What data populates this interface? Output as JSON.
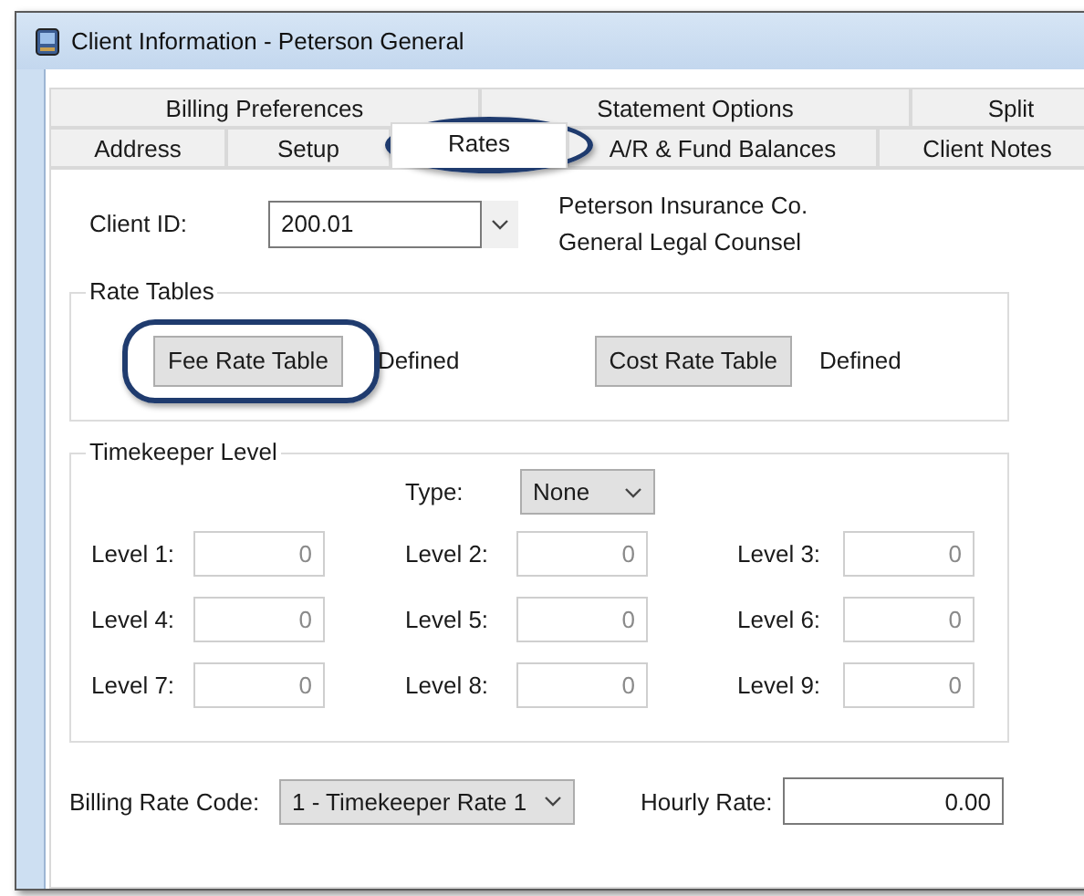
{
  "window": {
    "title": "Client Information - Peterson General"
  },
  "tab_rows": [
    {
      "tabs": [
        {
          "label": "Billing Preferences",
          "selected": false,
          "highlighted": false
        },
        {
          "label": "Statement Options",
          "selected": false,
          "highlighted": false
        },
        {
          "label": "Split",
          "selected": false,
          "highlighted": false
        }
      ]
    },
    {
      "tabs": [
        {
          "label": "Address",
          "selected": false,
          "highlighted": false
        },
        {
          "label": "Setup",
          "selected": false,
          "highlighted": false
        },
        {
          "label": "Rates",
          "selected": true,
          "highlighted": true
        },
        {
          "label": "A/R & Fund Balances",
          "selected": false,
          "highlighted": false
        },
        {
          "label": "Client Notes",
          "selected": false,
          "highlighted": false
        }
      ]
    }
  ],
  "client": {
    "label": "Client ID:",
    "value": "200.01",
    "names": [
      "Peterson Insurance Co.",
      "General Legal Counsel"
    ]
  },
  "rate_tables": {
    "title": "Rate Tables",
    "items": [
      {
        "button": "Fee Rate Table",
        "status": "Defined",
        "highlighted": true
      },
      {
        "button": "Cost Rate Table",
        "status": "Defined",
        "highlighted": false
      }
    ]
  },
  "timekeeper_level": {
    "title": "Timekeeper Level",
    "type_label": "Type:",
    "type_value": "None",
    "levels": [
      {
        "label": "Level 1:",
        "value": "0",
        "disabled": true
      },
      {
        "label": "Level 2:",
        "value": "0",
        "disabled": true
      },
      {
        "label": "Level 3:",
        "value": "0",
        "disabled": true
      },
      {
        "label": "Level 4:",
        "value": "0",
        "disabled": true
      },
      {
        "label": "Level 5:",
        "value": "0",
        "disabled": true
      },
      {
        "label": "Level 6:",
        "value": "0",
        "disabled": true
      },
      {
        "label": "Level 7:",
        "value": "0",
        "disabled": true
      },
      {
        "label": "Level 8:",
        "value": "0",
        "disabled": true
      },
      {
        "label": "Level 9:",
        "value": "0",
        "disabled": true
      }
    ]
  },
  "billing_rate_code": {
    "label": "Billing Rate Code:",
    "value": "1 - Timekeeper Rate 1"
  },
  "hourly_rate": {
    "label": "Hourly Rate:",
    "value": "0.00"
  }
}
